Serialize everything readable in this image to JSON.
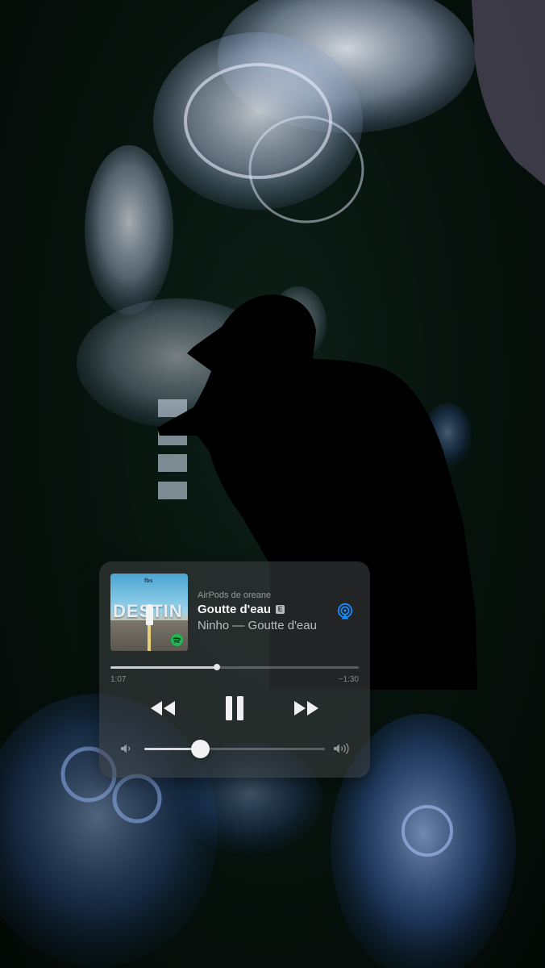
{
  "now_playing": {
    "route": "AirPods de oreane",
    "title": "Goutte d'eau",
    "explicit": "E",
    "subtitle": "Ninho — Goutte d'eau",
    "artwork_text": "DESTIN",
    "artwork_brand": "fbs",
    "accent_color": "#1a8cff",
    "spotify_color": "#1db954"
  },
  "progress": {
    "elapsed": "1:07",
    "remaining": "−1:30",
    "fraction": 0.43
  },
  "volume": {
    "fraction": 0.31
  },
  "icons": {
    "prev": "backward-icon",
    "play_pause": "pause-icon",
    "next": "forward-icon",
    "airplay": "airplay-icon",
    "volume_low": "speaker-low-icon",
    "volume_high": "speaker-high-icon"
  }
}
